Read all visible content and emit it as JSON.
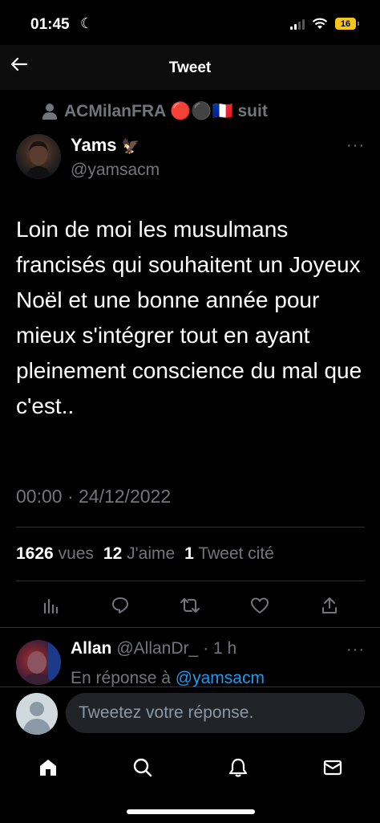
{
  "status_bar": {
    "time": "01:45",
    "battery": "16"
  },
  "header": {
    "title": "Tweet"
  },
  "tweet": {
    "social_context": "ACMilanFRA 🔴⚫🇫🇷 suit",
    "display_name": "Yams",
    "name_emoji": "🦅",
    "username": "@yamsacm",
    "text": "Loin de moi les musulmans francisés qui souhaitent un Joyeux Noël et une bonne année pour mieux s'intégrer tout en ayant pleinement conscience du mal que c'est..",
    "timestamp": "00:00 · 24/12/2022",
    "stats": {
      "views_count": "1626",
      "views_label": "vues",
      "likes_count": "12",
      "likes_label": "J'aime",
      "quotes_count": "1",
      "quotes_label": "Tweet cité"
    },
    "more": "···"
  },
  "reply": {
    "display_name": "Allan",
    "username": "@AllanDr_",
    "time": "· 1 h",
    "replying_prefix": "En réponse à",
    "replying_to": "@yamsacm",
    "more": "···"
  },
  "compose": {
    "placeholder": "Tweetez votre réponse."
  },
  "colors": {
    "accent": "#1d9bf0",
    "muted": "#71767b",
    "background": "#000000"
  }
}
